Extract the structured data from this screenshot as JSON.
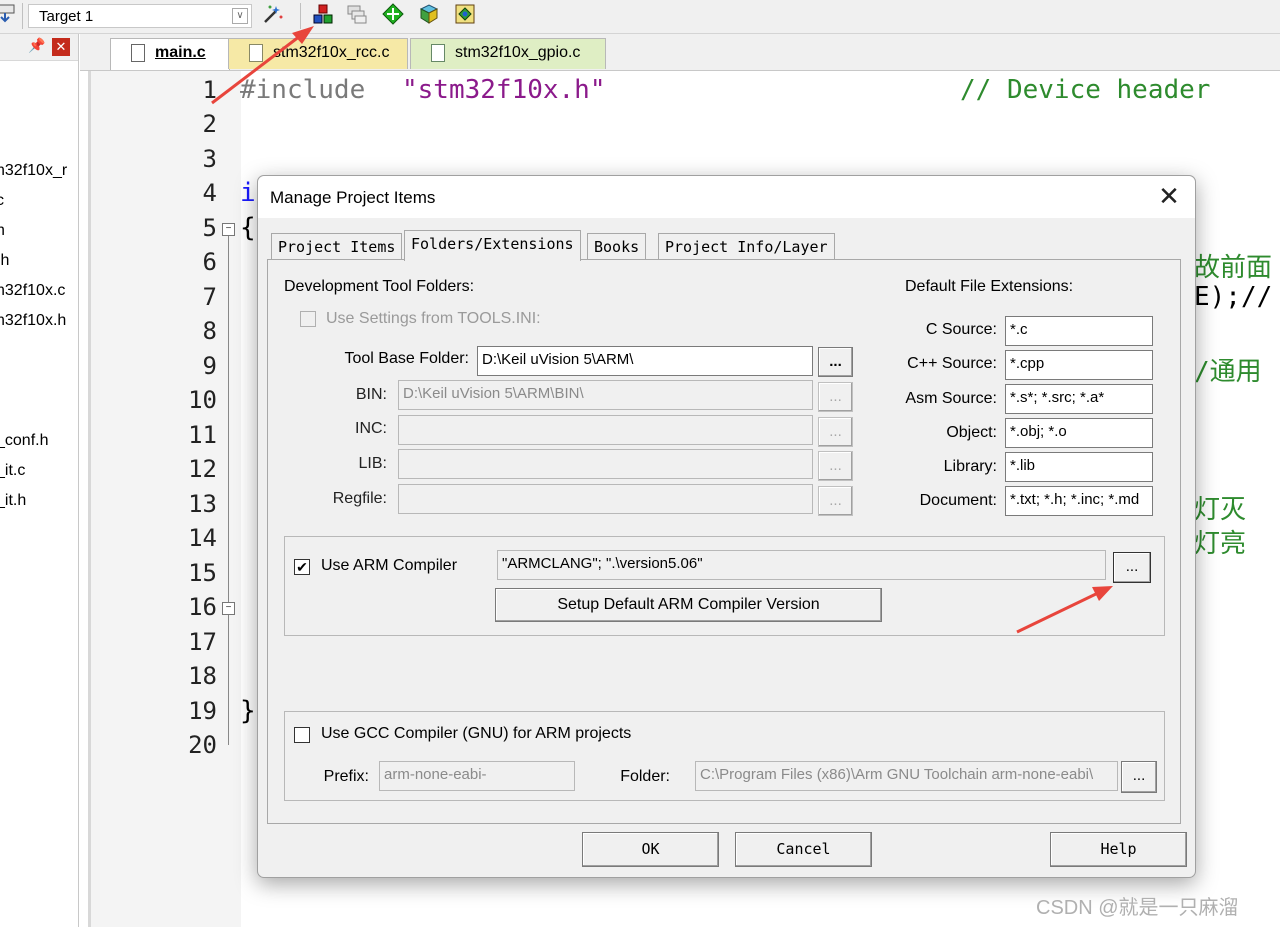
{
  "toolbar": {
    "target": "Target 1",
    "icons": [
      "load-icon",
      "target-dropdown-icon",
      "magic-wand-icon",
      "manage-project-items-icon",
      "stack-icon",
      "green-diamond-icon",
      "pack-installer-icon",
      "select-packs-icon"
    ]
  },
  "left_panel": {
    "items": [
      "n32f10x_r",
      "c",
      "h",
      ".h",
      "n32f10x.c",
      "n32f10x.h",
      "_conf.h",
      "_it.c",
      "_it.h"
    ]
  },
  "file_tabs": [
    "main.c",
    "stm32f10x_rcc.c",
    "stm32f10x_gpio.c"
  ],
  "editor": {
    "line_numbers": [
      "1",
      "2",
      "3",
      "4",
      "5",
      "6",
      "7",
      "8",
      "9",
      "10",
      "11",
      "12",
      "13",
      "14",
      "15",
      "16",
      "17",
      "18",
      "19",
      "20"
    ],
    "line1_directive": "#include",
    "line1_header": "\"stm32f10x.h\"",
    "line1_comment": "// Device header",
    "line4_fragment": "i",
    "line5_fragment": "{",
    "line19_fragment": "}",
    "right_fragments": [
      "故前面",
      "E);//",
      "/通用",
      "灯灭",
      "灯亮"
    ]
  },
  "dialog": {
    "title": "Manage Project Items",
    "close": "✕",
    "tabs": [
      "Project Items",
      "Folders/Extensions",
      "Books",
      "Project Info/Layer"
    ],
    "dev_tool_folders": "Development Tool Folders:",
    "use_tools_ini": "Use Settings from TOOLS.INI:",
    "tool_base_label": "Tool Base Folder:",
    "tool_base_value": "D:\\Keil uVision 5\\ARM\\",
    "bin_label": "BIN:",
    "bin_value": "D:\\Keil uVision 5\\ARM\\BIN\\",
    "inc_label": "INC:",
    "lib_label": "LIB:",
    "regfile_label": "Regfile:",
    "browse": "...",
    "default_ext": "Default File Extensions:",
    "ext": [
      {
        "label": "C Source:",
        "value": "*.c"
      },
      {
        "label": "C++ Source:",
        "value": "*.cpp"
      },
      {
        "label": "Asm Source:",
        "value": "*.s*; *.src; *.a*"
      },
      {
        "label": "Object:",
        "value": "*.obj; *.o"
      },
      {
        "label": "Library:",
        "value": "*.lib"
      },
      {
        "label": "Document:",
        "value": "*.txt; *.h; *.inc; *.md"
      }
    ],
    "use_arm_compiler": "Use ARM Compiler",
    "arm_compiler_value": "\"ARMCLANG\"; \".\\version5.06\"",
    "setup_default": "Setup Default ARM Compiler Version",
    "use_gcc": "Use GCC Compiler (GNU) for ARM projects",
    "prefix_label": "Prefix:",
    "prefix_value": "arm-none-eabi-",
    "folder_label": "Folder:",
    "folder_value": "C:\\Program Files (x86)\\Arm GNU Toolchain arm-none-eabi\\",
    "ok": "OK",
    "cancel": "Cancel",
    "help": "Help"
  },
  "watermark": "CSDN @就是一只麻溜",
  "colors": {
    "annotation_arrow": "#e8453c",
    "comment": "#2e8b2e",
    "string": "#8b1a8b",
    "keyword": "#1a1aff"
  }
}
